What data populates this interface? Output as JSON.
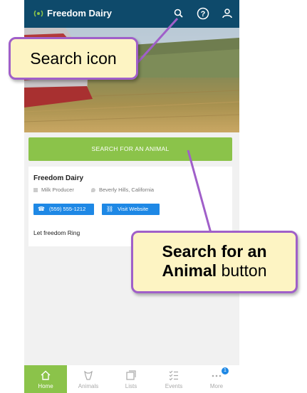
{
  "app": {
    "title": "Freedom Dairy"
  },
  "colors": {
    "topbar": "#0e4a6b",
    "accent_green": "#8bc34a",
    "pill_blue": "#1e88e5",
    "callout_fill": "#fdf4c3",
    "callout_border": "#a05fc9"
  },
  "topbar": {
    "icons": [
      "search-icon",
      "help-icon",
      "account-icon"
    ]
  },
  "main": {
    "search_button_label": "SEARCH FOR AN ANIMAL",
    "card": {
      "title": "Freedom Dairy",
      "type": "Milk Producer",
      "location": "Beverly Hills, California",
      "phone_label": "(559) 555-1212",
      "website_label": "Visit Website",
      "motto": "Let freedom Ring"
    }
  },
  "bottom_nav": {
    "items": [
      {
        "label": "Home",
        "icon": "home-icon",
        "active": true
      },
      {
        "label": "Animals",
        "icon": "animal-icon",
        "active": false
      },
      {
        "label": "Lists",
        "icon": "lists-icon",
        "active": false
      },
      {
        "label": "Events",
        "icon": "events-icon",
        "active": false
      },
      {
        "label": "More",
        "icon": "more-icon",
        "active": false
      }
    ],
    "more_badge": "1"
  },
  "annotations": {
    "search_icon_callout": "Search icon",
    "search_animal_callout_bold": "Search for an",
    "search_animal_callout_bold2": "Animal",
    "search_animal_callout_rest": "button"
  }
}
